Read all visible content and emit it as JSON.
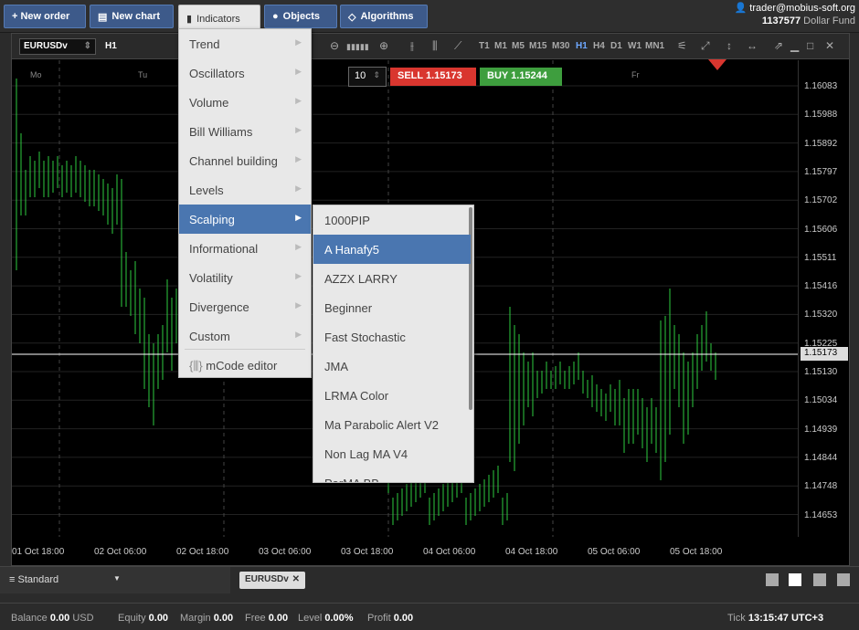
{
  "toolbar": {
    "new_order": "+ New order",
    "new_chart": "New chart",
    "indicators": "Indicators",
    "objects": "Objects",
    "algorithms": "Algorithms"
  },
  "account": {
    "user": "trader@mobius-soft.org",
    "id": "1137577",
    "fund": "Dollar Fund"
  },
  "chart": {
    "symbol": "EURUSDv",
    "timeframe": "H1",
    "quantity": "10",
    "sell": "SELL 1.15173",
    "buy": "BUY 1.15244",
    "timeframes": [
      "T1",
      "M1",
      "M5",
      "M15",
      "M30",
      "H1",
      "H4",
      "D1",
      "W1",
      "MN1"
    ],
    "days": [
      "Mo",
      "Tu",
      "Fr"
    ],
    "price_labels": [
      "1.16083",
      "1.15988",
      "1.15892",
      "1.15797",
      "1.15702",
      "1.15606",
      "1.15511",
      "1.15416",
      "1.15320",
      "1.15225",
      "1.15130",
      "1.15034",
      "1.14939",
      "1.14844",
      "1.14748",
      "1.14653"
    ],
    "current_price": "1.15173",
    "time_labels": [
      "01 Oct 18:00",
      "02 Oct 06:00",
      "02 Oct 18:00",
      "03 Oct 06:00",
      "03 Oct 18:00",
      "04 Oct 06:00",
      "04 Oct 18:00",
      "05 Oct 06:00",
      "05 Oct 18:00"
    ]
  },
  "menu": {
    "items": [
      "Trend",
      "Oscillators",
      "Volume",
      "Bill Williams",
      "Channel building",
      "Levels",
      "Scalping",
      "Informational",
      "Volatility",
      "Divergence",
      "Custom"
    ],
    "editor": "mCode editor"
  },
  "submenu": {
    "items": [
      "1000PIP",
      "A Hanafy5",
      "AZZX LARRY",
      "Beginner",
      "Fast Stochastic",
      "JMA",
      "LRMA Color",
      "Ma Parabolic Alert V2",
      "Non Lag MA V4",
      "ParMA BB"
    ]
  },
  "bottom": {
    "workspace": "Standard",
    "tab": "EURUSDv"
  },
  "status": {
    "balance_label": "Balance",
    "balance": "0.00",
    "currency": "USD",
    "equity_label": "Equity",
    "equity": "0.00",
    "margin_label": "Margin",
    "margin": "0.00",
    "free_label": "Free",
    "free": "0.00",
    "level_label": "Level",
    "level": "0.00%",
    "profit_label": "Profit",
    "profit": "0.00",
    "tick_label": "Tick",
    "tick": "13:15:47",
    "tz": "UTC+3"
  }
}
